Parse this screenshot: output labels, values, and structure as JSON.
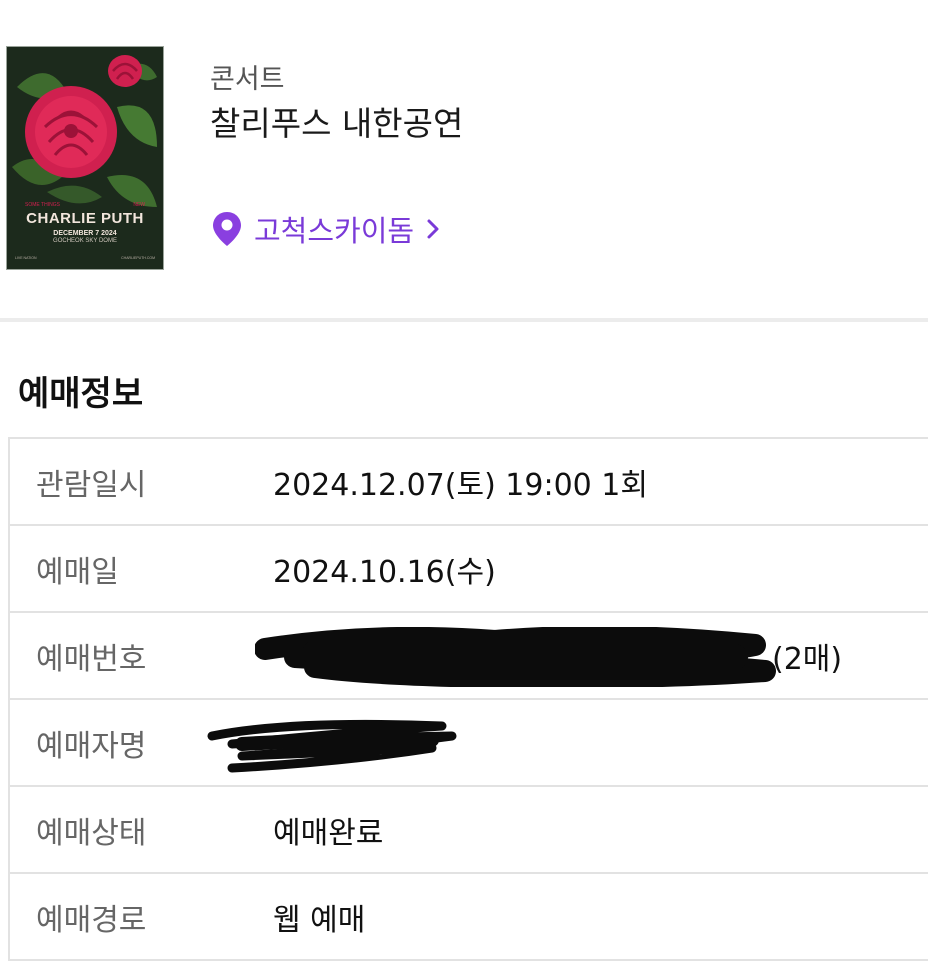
{
  "poster": {
    "top_line_left": "SOME THINGS",
    "top_line_right": "NEW",
    "artist": "CHARLIE PUTH",
    "date": "DECEMBER 7 2024",
    "venue": "GOCHEOK SKY DOME",
    "footer_left": "LIVE NATION",
    "footer_right": "CHARLIEPUTH.COM"
  },
  "header": {
    "category": "콘서트",
    "title": "찰리푸스 내한공연",
    "venue": "고척스카이돔"
  },
  "booking_info": {
    "section_title": "예매정보",
    "rows": [
      {
        "label": "관람일시",
        "value": "2024.12.07(토) 19:00 1회"
      },
      {
        "label": "예매일",
        "value": "2024.10.16(수)"
      },
      {
        "label": "예매번호",
        "value": "(2매)"
      },
      {
        "label": "예매자명",
        "value": ""
      },
      {
        "label": "예매상태",
        "value": "예매완료"
      },
      {
        "label": "예매경로",
        "value": "웹 예매"
      }
    ]
  },
  "colors": {
    "accent": "#7a3ad8",
    "rose": "#d0204f",
    "leaf": "#3e6b2e"
  }
}
